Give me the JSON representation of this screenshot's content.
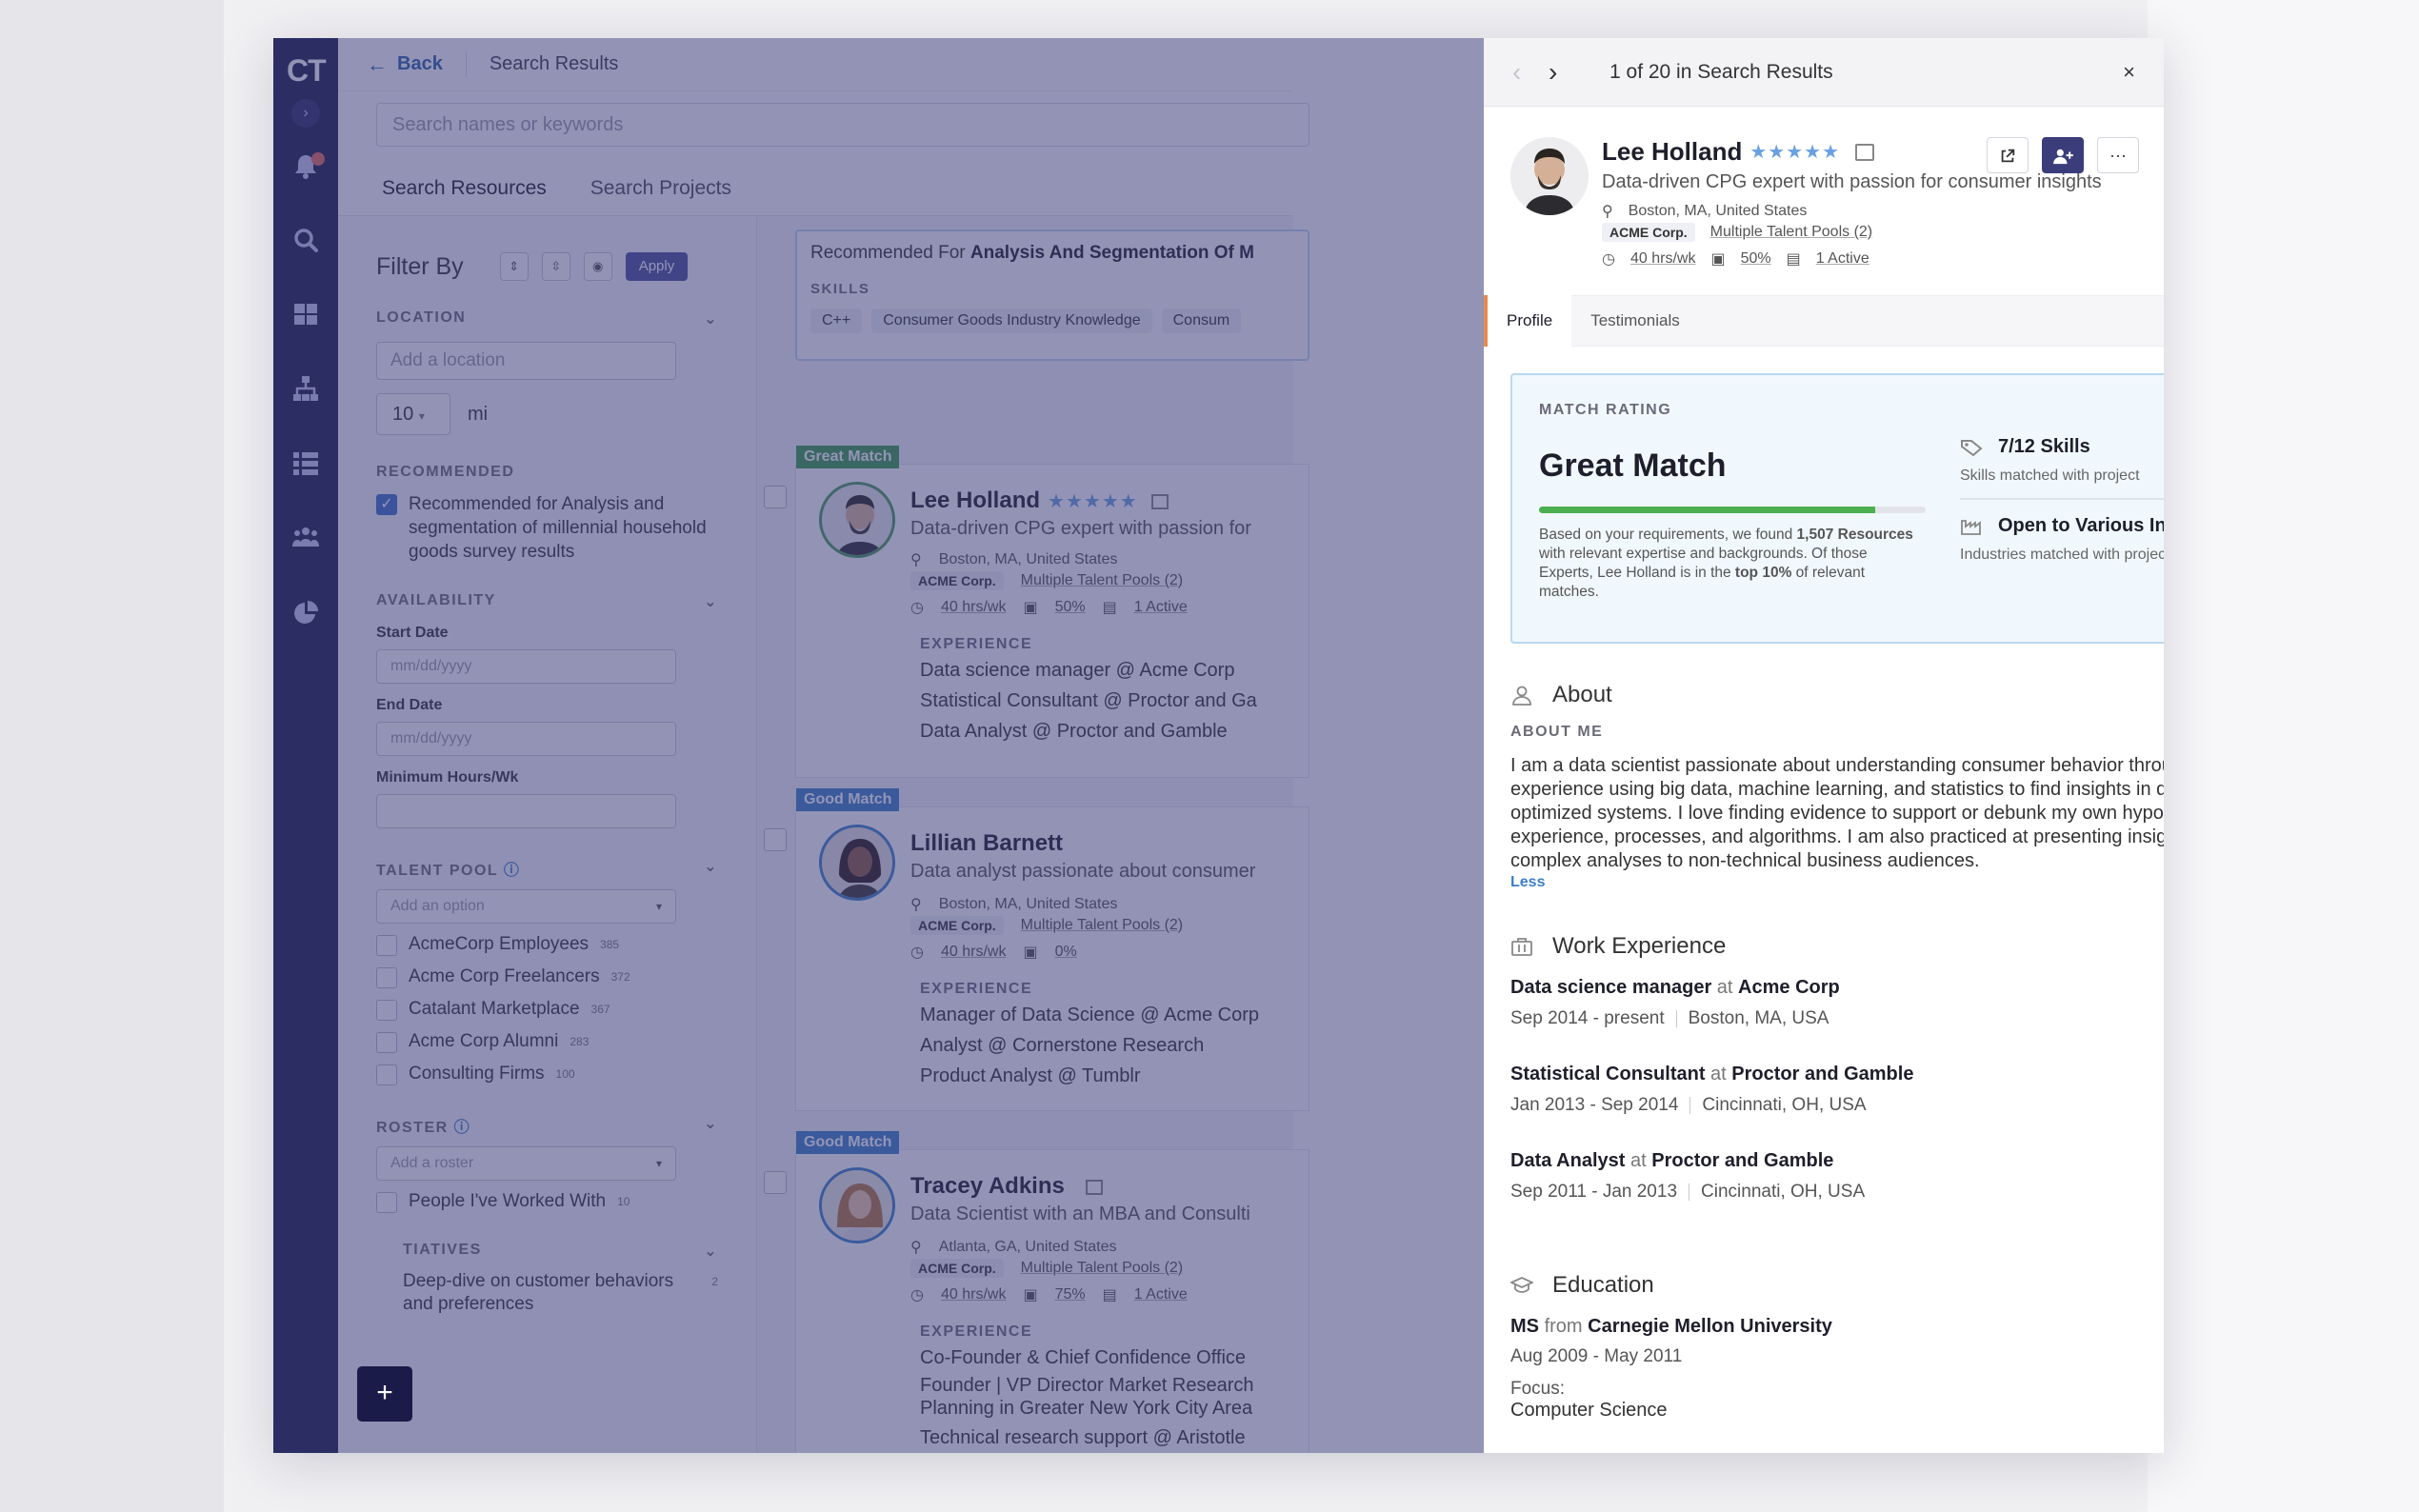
{
  "nav": {
    "logo": "CT",
    "expand_glyph": "›"
  },
  "header": {
    "back_label": "Back",
    "breadcrumb": "Search Results"
  },
  "search": {
    "placeholder": "Search names or keywords"
  },
  "tabs": {
    "resources": "Search Resources",
    "projects": "Search Projects"
  },
  "filters": {
    "title": "Filter By",
    "apply": "Apply",
    "location": {
      "label": "LOCATION",
      "placeholder": "Add a location",
      "radius": "10",
      "unit": "mi"
    },
    "recommended": {
      "label": "RECOMMENDED",
      "option": "Recommended for Analysis and segmentation of millennial household goods survey results"
    },
    "availability": {
      "label": "AVAILABILITY",
      "start_label": "Start Date",
      "start_placeholder": "mm/dd/yyyy",
      "end_label": "End Date",
      "end_placeholder": "mm/dd/yyyy",
      "min_hours_label": "Minimum Hours/Wk"
    },
    "talent_pool": {
      "label": "TALENT POOL",
      "placeholder": "Add an option",
      "items": [
        {
          "name": "AcmeCorp Employees",
          "count": "385"
        },
        {
          "name": "Acme Corp Freelancers",
          "count": "372"
        },
        {
          "name": "Catalant Marketplace",
          "count": "367"
        },
        {
          "name": "Acme Corp Alumni",
          "count": "283"
        },
        {
          "name": "Consulting Firms",
          "count": "100"
        }
      ]
    },
    "roster": {
      "label": "ROSTER",
      "placeholder": "Add a roster",
      "item": "People I've Worked With",
      "count": "10"
    },
    "initiatives": {
      "label": "TIATIVES",
      "item": "Deep-dive on customer behaviors and preferences",
      "count": "2"
    }
  },
  "recommended_box": {
    "prefix": "Recommended For",
    "project": "Analysis And Segmentation Of M",
    "skills_label": "SKILLS",
    "skills": [
      "C++",
      "Consumer Goods Industry Knowledge",
      "Consum"
    ]
  },
  "results": [
    {
      "badge": "Great Match",
      "name": "Lee Holland",
      "stars": "★★★★★",
      "desc": "Data-driven CPG expert with passion for",
      "location": "Boston, MA, United States",
      "company": "ACME Corp.",
      "pools": "Multiple Talent Pools (2)",
      "hours": "40 hrs/wk",
      "util": "50%",
      "active": "1 Active",
      "exp_label": "EXPERIENCE",
      "exp": [
        "Data science manager @ Acme Corp",
        "Statistical Consultant @ Proctor and Ga",
        "Data Analyst @ Proctor and Gamble"
      ]
    },
    {
      "badge": "Good Match",
      "name": "Lillian Barnett",
      "stars": "",
      "desc": "Data analyst passionate about consumer",
      "location": "Boston, MA, United States",
      "company": "ACME Corp.",
      "pools": "Multiple Talent Pools (2)",
      "hours": "40 hrs/wk",
      "util": "0%",
      "active": "",
      "exp_label": "EXPERIENCE",
      "exp": [
        "Manager of Data Science @ Acme Corp",
        "Analyst @ Cornerstone Research",
        "Product Analyst @ Tumblr"
      ]
    },
    {
      "badge": "Good Match",
      "name": "Tracey Adkins",
      "stars": "",
      "desc": "Data Scientist with an MBA and Consulti",
      "location": "Atlanta, GA, United States",
      "company": "ACME Corp.",
      "pools": "Multiple Talent Pools (2)",
      "hours": "40 hrs/wk",
      "util": "75%",
      "active": "1 Active",
      "exp_label": "EXPERIENCE",
      "exp": [
        "Co-Founder & Chief Confidence Office",
        "Founder | VP Director Market Research",
        "Planning in Greater New York City Area",
        "Technical research support @ Aristotle"
      ]
    }
  ],
  "fab": "+",
  "detail": {
    "pager": {
      "prev": "‹",
      "next": "›",
      "position": "1 of 20 in Search Results",
      "close": "×"
    },
    "name": "Lee Holland",
    "stars": "★★★★★",
    "tagline": "Data-driven CPG expert with passion for consumer insights",
    "location": "Boston, MA, United States",
    "company": "ACME Corp.",
    "pools": "Multiple Talent Pools (2)",
    "hours": "40 hrs/wk",
    "util": "50%",
    "active": "1 Active",
    "tabs": {
      "profile": "Profile",
      "testimonials": "Testimonials"
    },
    "match": {
      "label": "MATCH RATING",
      "rating": "Great Match",
      "rating_fill": 0.87,
      "blurb_1": "Based on your requirements, we found ",
      "blurb_count": "1,507 Resources",
      "blurb_2": " with relevant expertise and backgrounds. Of those Experts, Lee Holland is in the ",
      "blurb_top": "top 10%",
      "blurb_3": " of relevant matches.",
      "skills": "7/12 Skills",
      "skills_fill": 0.58,
      "skills_sub": "Skills matched with project",
      "industries": "Open to Various Industries",
      "industries_sub": "Industries matched with project"
    },
    "about": {
      "title": "About",
      "label": "ABOUT ME",
      "text": "I am a data scientist passionate about understanding consumer behavior through data learning. I have experience using big data, machine learning, and statistics to find insights in data and build highly optimized systems. I love finding evidence to support or debunk my own hypotheses on optimal user experience, processes, and algorithms. I am also practiced at presenting insights and explaining complex analyses to non-technical business audiences.",
      "less": "Less"
    },
    "work": {
      "title": "Work Experience",
      "at": "at",
      "jobs": [
        {
          "role": "Data science manager",
          "company": "Acme Corp",
          "dates": "Sep 2014  - present",
          "place": "Boston, MA, USA"
        },
        {
          "role": "Statistical Consultant",
          "company": "Proctor and Gamble",
          "dates": "Jan 2013  - Sep 2014",
          "place": "Cincinnati, OH, USA"
        },
        {
          "role": "Data Analyst",
          "company": "Proctor and Gamble",
          "dates": "Sep 2011  - Jan 2013",
          "place": "Cincinnati, OH, USA"
        }
      ]
    },
    "education": {
      "title": "Education",
      "degree": "MS",
      "from": "from",
      "school": "Carnegie Mellon University",
      "dates": "Aug 2009 - May 2011",
      "focus_label": "Focus:",
      "focus": "Computer Science"
    }
  }
}
